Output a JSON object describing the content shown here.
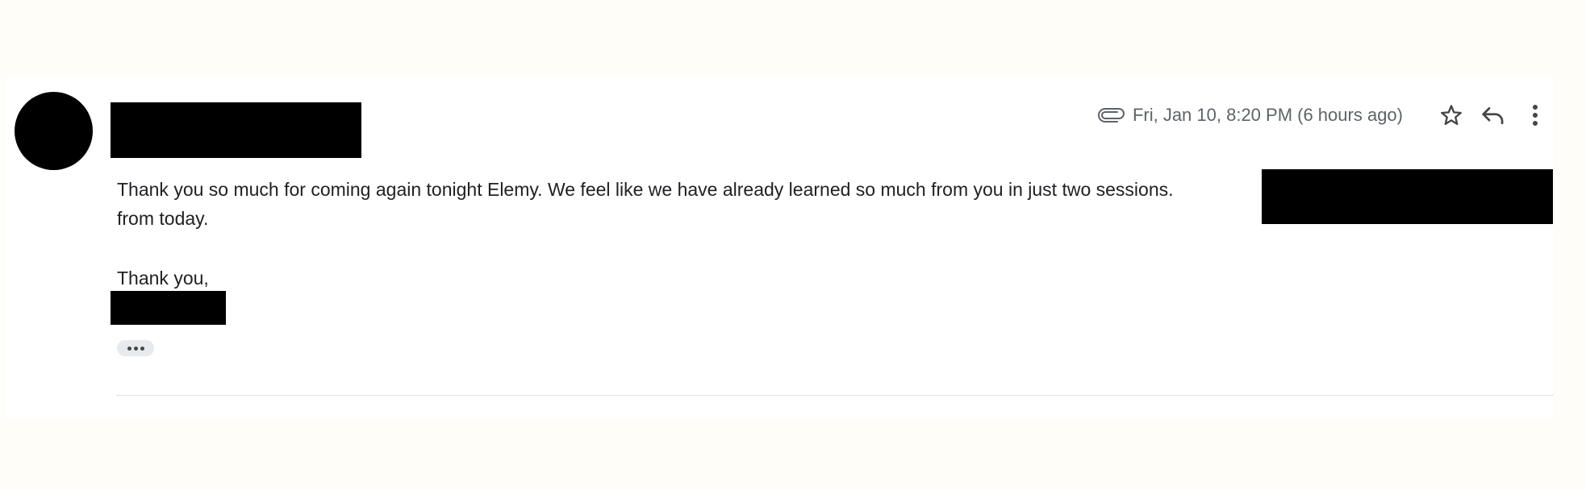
{
  "email": {
    "date": "Fri, Jan 10, 8:20 PM (6 hours ago)",
    "body_line_1": "Thank you so much for coming again tonight Elemy. We feel like we have already learned so much from you in just two sessions.",
    "body_line_2": "from today.",
    "closing": "Thank you,"
  },
  "icons": {
    "attachment": "paperclip-icon",
    "star": "star-icon",
    "reply": "reply-icon",
    "more": "more-vert-icon",
    "show_trimmed": "ellipsis-icon"
  },
  "colors": {
    "page_background": "#fffdf8",
    "card_background": "#ffffff",
    "text": "#202124",
    "meta_text": "#5f6368",
    "icon": "#444746",
    "redaction": "#000000"
  }
}
